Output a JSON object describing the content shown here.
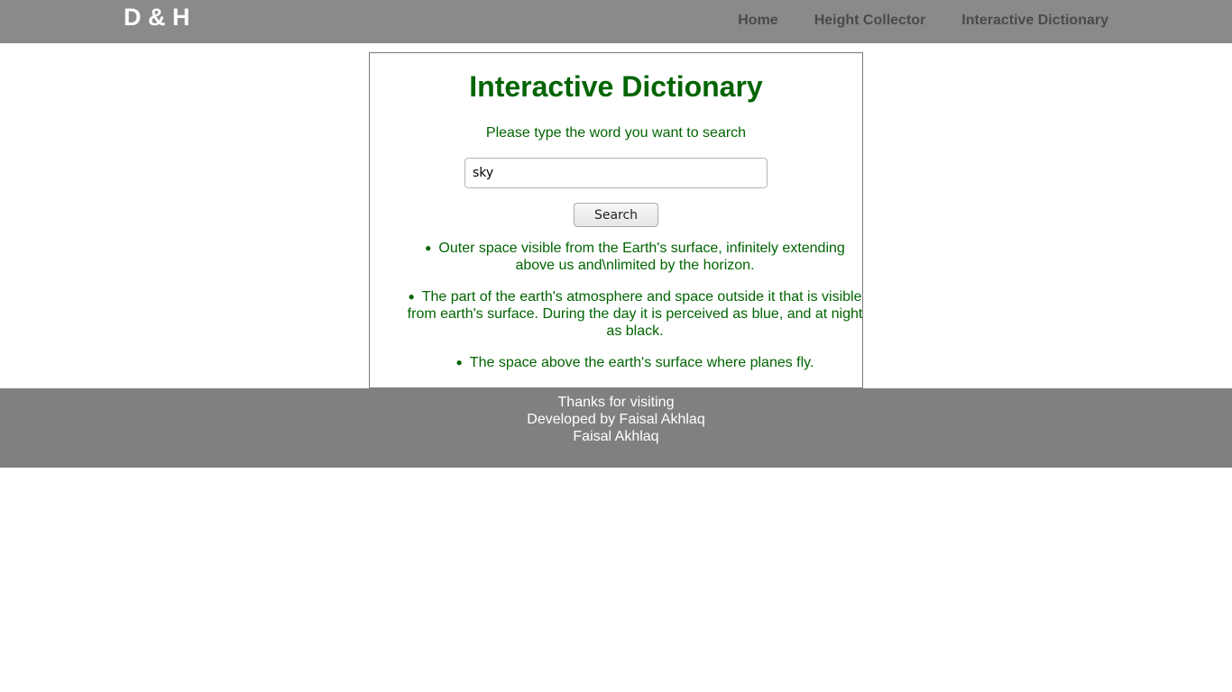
{
  "header": {
    "logo": "D & H",
    "nav": [
      {
        "label": "Home"
      },
      {
        "label": "Height Collector"
      },
      {
        "label": "Interactive Dictionary"
      }
    ]
  },
  "main": {
    "title": "Interactive Dictionary",
    "prompt": "Please type the word you want to search",
    "search": {
      "value": "sky",
      "button_label": "Search"
    },
    "results": [
      "Outer space visible from the Earth's surface, infinitely extending above us and\\nlimited by the horizon.",
      "The part of the earth's atmosphere and space outside it that is visible from earth's surface. During the day it is perceived as blue, and at night as black.",
      "The space above the earth's surface where planes fly."
    ]
  },
  "footer": {
    "line1": "Thanks for visiting",
    "line2": "Developed by Faisal Akhlaq",
    "line3": "Faisal Akhlaq"
  },
  "colors": {
    "header_bg": "#8a8a8a",
    "footer_bg": "#808080",
    "accent_green": "#006400"
  }
}
